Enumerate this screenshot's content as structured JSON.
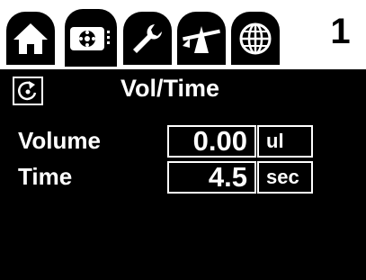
{
  "tabs": [
    {
      "icon": "home-icon"
    },
    {
      "icon": "pipette-dispense-icon",
      "active": true
    },
    {
      "icon": "wrench-icon"
    },
    {
      "icon": "balance-scale-icon"
    },
    {
      "icon": "globe-icon"
    }
  ],
  "mode_number": "1",
  "screen": {
    "title": "Vol/Time",
    "reload_icon": "reload-icon",
    "volume": {
      "label": "Volume",
      "value": "0.00",
      "unit": "ul"
    },
    "time": {
      "label": "Time",
      "value": "4.5",
      "unit": "sec"
    }
  },
  "colors": {
    "background": "#000000",
    "foreground": "#ffffff"
  }
}
